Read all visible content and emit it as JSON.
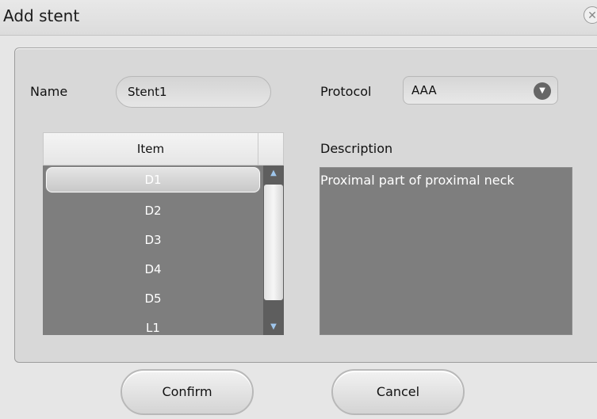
{
  "dialog": {
    "title": "Add stent",
    "close_icon": "close-icon"
  },
  "form": {
    "name_label": "Name",
    "name_value": "Stent1",
    "protocol_label": "Protocol",
    "protocol_value": "AAA",
    "protocol_icon": "chevron-down-icon"
  },
  "items": {
    "header": "Item",
    "list": [
      "D1",
      "D2",
      "D3",
      "D4",
      "D5",
      "L1"
    ],
    "selected": "D1"
  },
  "description": {
    "label": "Description",
    "text": "Proximal part of proximal neck"
  },
  "buttons": {
    "confirm": "Confirm",
    "cancel": "Cancel"
  }
}
